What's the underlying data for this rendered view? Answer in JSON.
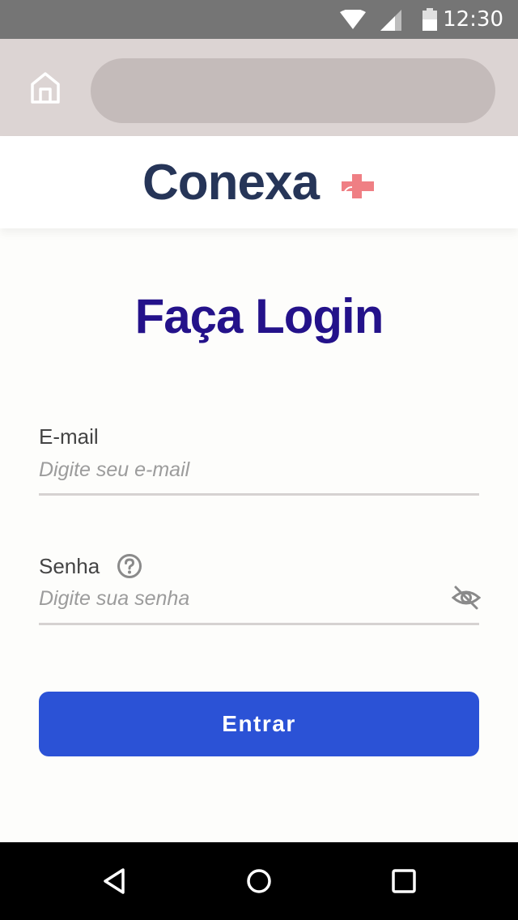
{
  "status_bar": {
    "time": "12:30",
    "icons": [
      "wifi-icon",
      "signal-icon",
      "battery-icon"
    ]
  },
  "browser": {
    "home_icon": "home-icon",
    "address_value": ""
  },
  "header": {
    "logo_text": "Conexa",
    "logo_mark": "cross-plus-logo",
    "logo_text_color": "#263558",
    "logo_mark_color": "#ef7f84"
  },
  "page": {
    "title": "Faça Login",
    "title_color": "#24128a"
  },
  "form": {
    "email": {
      "label": "E-mail",
      "placeholder": "Digite seu e-mail",
      "value": ""
    },
    "password": {
      "label": "Senha",
      "placeholder": "Digite sua senha",
      "value": "",
      "help_icon": "help-circle-icon",
      "toggle_icon": "eye-off-icon"
    },
    "submit_label": "Entrar",
    "submit_color": "#2b52d6"
  },
  "nav_bar": {
    "buttons": [
      "back-triangle-icon",
      "home-circle-icon",
      "recents-square-icon"
    ]
  }
}
